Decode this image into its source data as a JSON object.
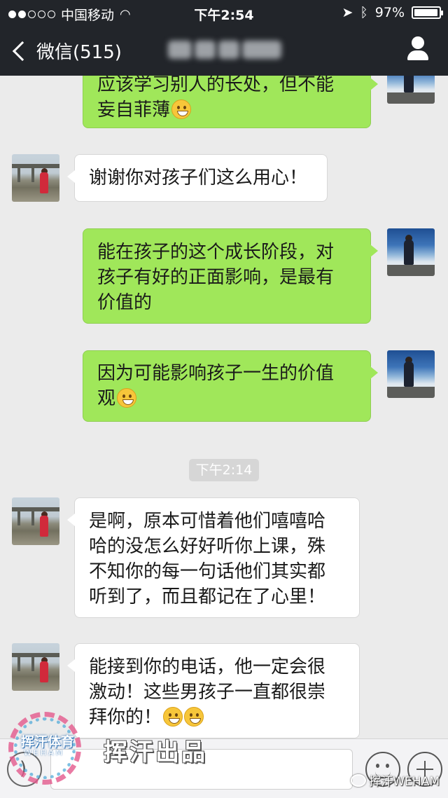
{
  "status_bar": {
    "carrier": "中国移动",
    "time": "下午2:54",
    "battery": "97%",
    "battery_fraction": 0.97
  },
  "nav": {
    "back_label": "微信(515)"
  },
  "messages": [
    {
      "side": "right",
      "lines": [
        "应该学习别人的长处，但不能",
        "妄自菲薄"
      ],
      "emoji": "grin-emoji"
    },
    {
      "side": "left",
      "lines": [
        "谢谢你对孩子们这么用心！"
      ]
    },
    {
      "side": "right",
      "lines": [
        "能在孩子的这个成长阶段，对",
        "孩子有好的正面影响，是最有",
        "价值的"
      ]
    },
    {
      "side": "right",
      "lines": [
        "因为可能影响孩子一生的价值",
        "观"
      ],
      "emoji": "wink-tongue-emoji"
    },
    {
      "side": "left",
      "lines": [
        "是啊，原本可惜着他们嘻嘻哈",
        "哈的没怎么好好听你上课，殊",
        "不知你的每一句话他们其实都",
        "听到了，而且都记在了心里！"
      ]
    },
    {
      "side": "left",
      "lines": [
        "能接到你的电话，他一定会很",
        "激动！这些男孩子一直都很崇",
        "拜你的！"
      ],
      "emoji": "smile-emoji"
    }
  ],
  "timestamp": "下午2:14",
  "watermark": {
    "brand": "挥汗体育",
    "brand_latin": "WEHAM",
    "slogan": "挥汗出品",
    "corner": "挥汗WEHAM"
  },
  "colors": {
    "nav_bg": "#22252a",
    "chat_bg": "#ebebeb",
    "bubble_right": "#a0e75a",
    "bubble_left": "#ffffff"
  }
}
